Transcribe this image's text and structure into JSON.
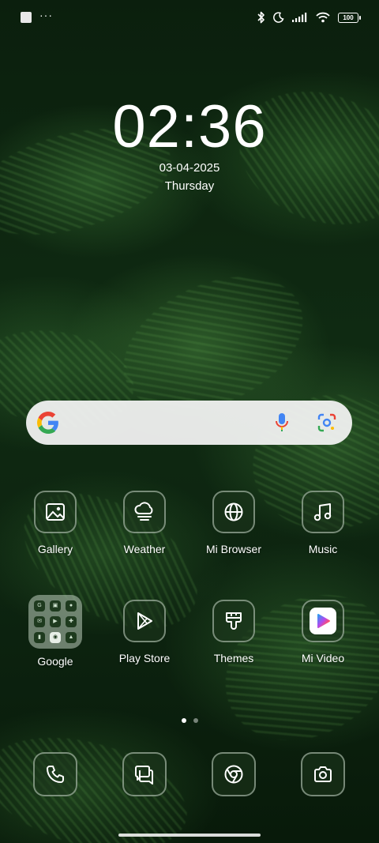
{
  "status_bar": {
    "more_indicator": "···",
    "battery_level": "100"
  },
  "clock": {
    "time": "02:36",
    "date": "03-04-2025",
    "day": "Thursday"
  },
  "search": {
    "icons": [
      "google-logo-icon",
      "microphone-icon",
      "lens-icon"
    ]
  },
  "apps": [
    {
      "label": "Gallery",
      "icon": "gallery-icon"
    },
    {
      "label": "Weather",
      "icon": "weather-icon"
    },
    {
      "label": "Mi Browser",
      "icon": "globe-icon"
    },
    {
      "label": "Music",
      "icon": "music-note-icon"
    },
    {
      "label": "Google",
      "icon": "folder-icon"
    },
    {
      "label": "Play Store",
      "icon": "play-store-icon"
    },
    {
      "label": "Themes",
      "icon": "brush-icon"
    },
    {
      "label": "Mi Video",
      "icon": "video-play-icon"
    }
  ],
  "pages": {
    "count": 2,
    "active": 1
  },
  "dock": [
    {
      "icon": "phone-icon"
    },
    {
      "icon": "messages-icon"
    },
    {
      "icon": "chrome-icon"
    },
    {
      "icon": "camera-icon"
    }
  ],
  "colors": {
    "tile_border": "#c8d7c8",
    "search_bg": "#f5f5f5",
    "google_blue": "#4285F4",
    "google_red": "#EA4335",
    "google_yellow": "#FBBC05",
    "google_green": "#34A853"
  }
}
